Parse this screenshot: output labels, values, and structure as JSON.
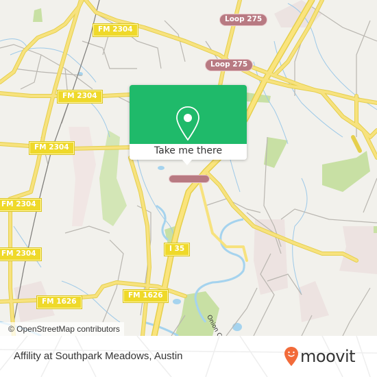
{
  "map": {
    "background_color": "#f2f1ec",
    "road_labels": {
      "fm2304_top": "FM 2304",
      "fm2304_mid": "FM 2304",
      "fm2304_left": "FM 2304",
      "fm2304_left2": "FM 2304",
      "fm2304_left3": "FM 2304",
      "loop275_top": "Loop 275",
      "loop275_mid": "Loop 275",
      "i35": "I 35",
      "fm1626_left": "FM 1626",
      "fm1626_mid": "FM 1626"
    },
    "street_labels": {
      "onion_creek": "Onion C"
    },
    "attribution": "© OpenStreetMap contributors"
  },
  "popup": {
    "action_label": "Take me there",
    "accent_color": "#1fba6a",
    "icon": "map-pin-icon"
  },
  "footer": {
    "place_name": "Affility at Southpark Meadows, Austin",
    "brand": "moovit",
    "brand_icon": "moovit-pin-icon",
    "brand_color": "#f26b3a"
  }
}
